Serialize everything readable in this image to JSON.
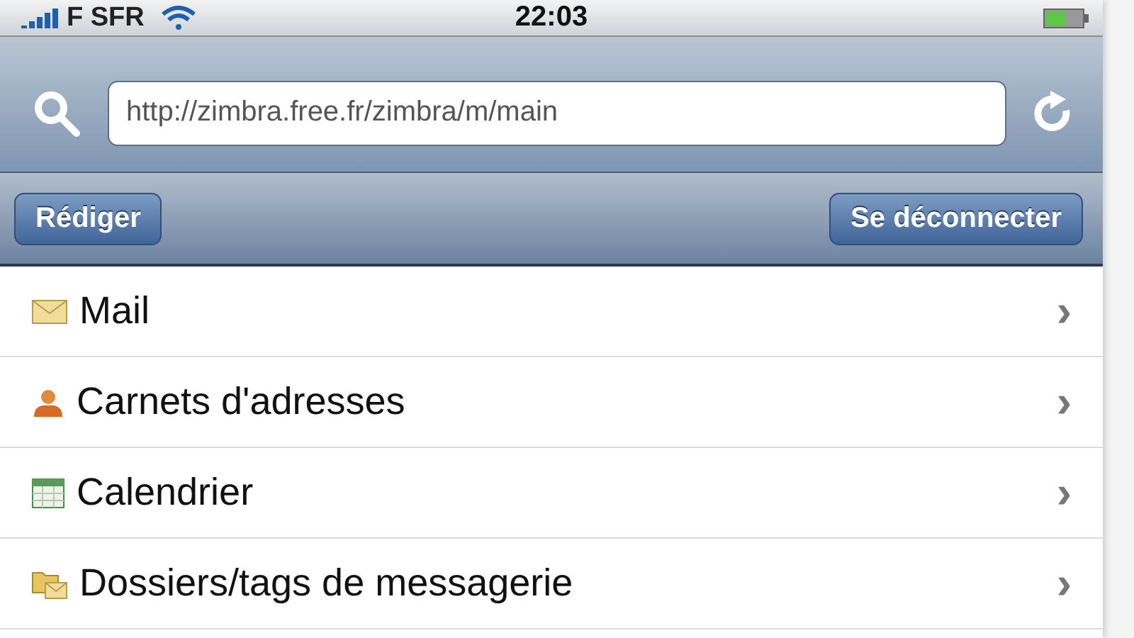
{
  "status_bar": {
    "carrier": "F SFR",
    "time": "22:03"
  },
  "address_bar": {
    "url": "http://zimbra.free.fr/zimbra/m/main"
  },
  "toolbar": {
    "buttons": [
      "Rédiger",
      "Se déconnecter"
    ]
  },
  "menu": [
    {
      "label": "Mail",
      "kind": "mail",
      "chevron": "›"
    },
    {
      "label": "Carnets d'adresses",
      "kind": "contacts",
      "chevron": "›"
    },
    {
      "label": "Calendrier",
      "kind": "calendar",
      "chevron": "›"
    },
    {
      "label": "Dossiers/tags de messagerie",
      "kind": "folders",
      "chevron": "›"
    }
  ]
}
